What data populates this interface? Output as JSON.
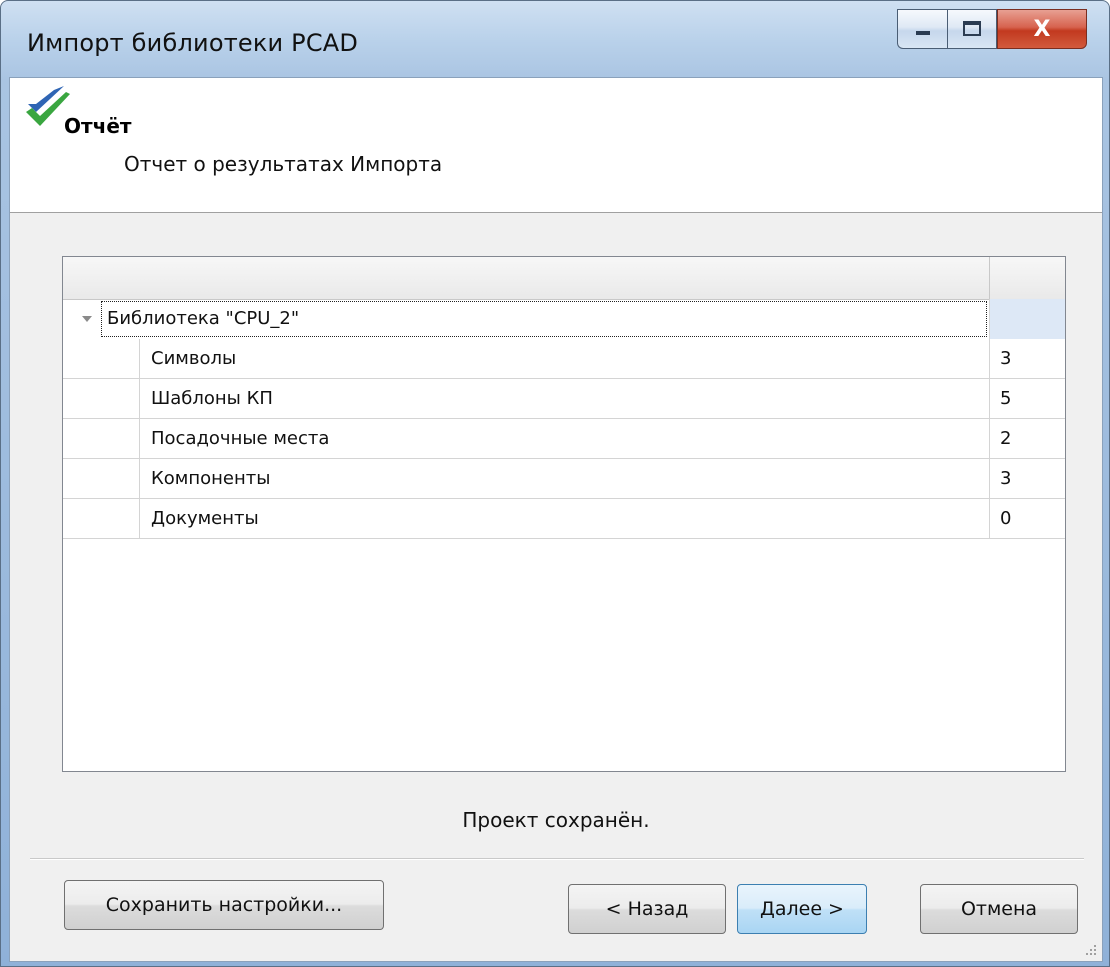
{
  "window": {
    "title": "Импорт библиотеки PCAD",
    "close_glyph": "X"
  },
  "header": {
    "title": "Отчёт",
    "subtitle": "Отчет  о результатах Импорта",
    "icon": "green-blue-checkmark-icon"
  },
  "tree": {
    "library": {
      "label": "Библиотека \"CPU_2\"",
      "value": ""
    },
    "items": [
      {
        "label": "Символы",
        "value": "3"
      },
      {
        "label": "Шаблоны КП",
        "value": "5"
      },
      {
        "label": "Посадочные места",
        "value": "2"
      },
      {
        "label": "Компоненты",
        "value": "3"
      },
      {
        "label": "Документы",
        "value": "0"
      }
    ]
  },
  "status": "Проект сохранён.",
  "buttons": {
    "save_settings": "Сохранить настройки...",
    "back": "< Назад",
    "next": "Далее >",
    "cancel": "Отмена"
  },
  "colors": {
    "title_bar": "#b9d1ea",
    "close_button": "#c2391f",
    "default_button": "#bfe0f7",
    "selected_cell": "#dde8f6"
  }
}
